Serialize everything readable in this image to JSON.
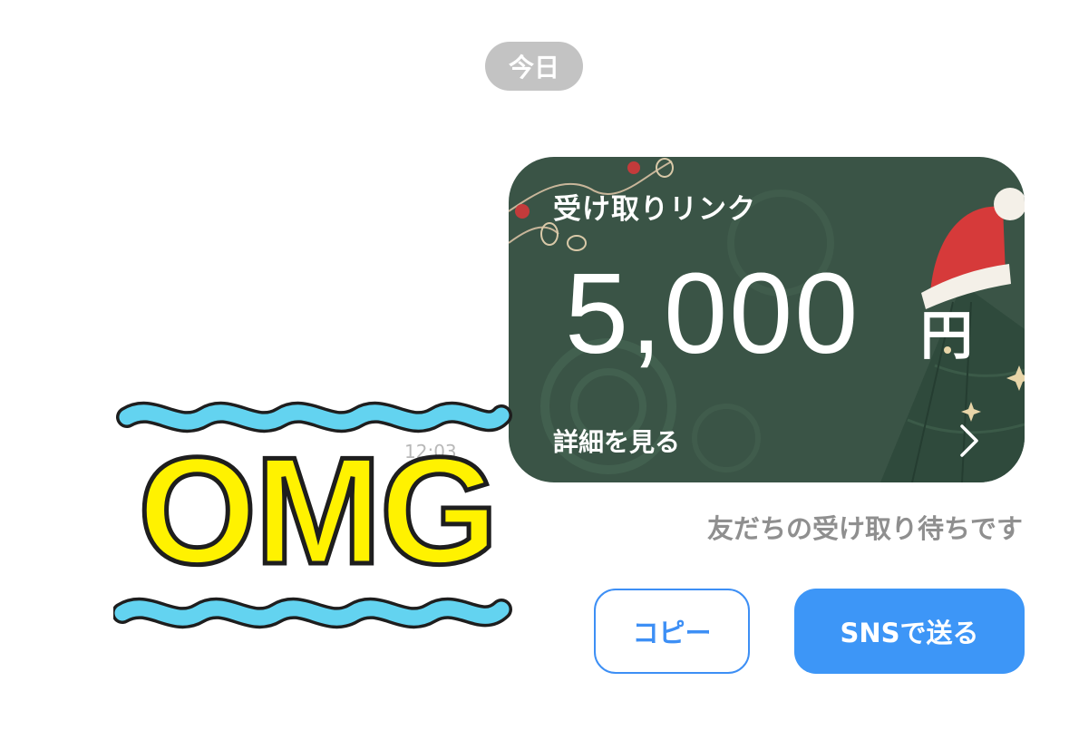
{
  "date_label": "今日",
  "gift_card": {
    "title": "受け取りリンク",
    "amount": "5,000",
    "currency": "円",
    "detail_label": "詳細を見る",
    "background_color": "#3a5446"
  },
  "sticker": {
    "text": "OMG",
    "fill_color": "#fff200",
    "wave_color": "#63d3f0"
  },
  "timestamp": "12:03",
  "status_text": "友だちの受け取り待ちです",
  "buttons": {
    "copy_label": "コピー",
    "sns_label": "SNSで送る"
  },
  "colors": {
    "accent": "#3d8ff5",
    "date_pill": "#c3c3c3"
  }
}
